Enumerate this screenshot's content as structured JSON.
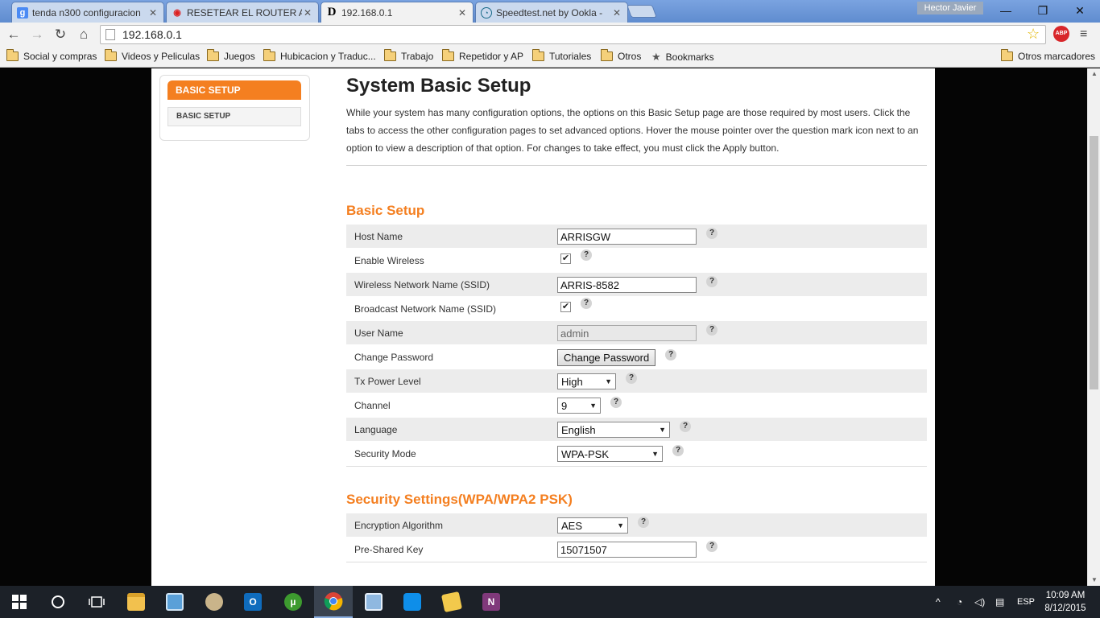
{
  "browser": {
    "tabs": [
      {
        "title": "tenda n300 configuracion",
        "favicon": "google-g-icon",
        "active": false
      },
      {
        "title": "RESETEAR EL ROUTER A L",
        "favicon": "youtube-play-icon",
        "active": false
      },
      {
        "title": "192.168.0.1",
        "favicon": "dlink-d-icon",
        "active": true
      },
      {
        "title": "Speedtest.net by Ookla - ",
        "favicon": "speedtest-gauge-icon",
        "active": false
      }
    ],
    "profile_name": "Hector Javier",
    "url": "192.168.0.1",
    "abp_label": "ABP",
    "bookmarks": [
      {
        "label": "Social y compras",
        "icon": "folder-icon"
      },
      {
        "label": "Videos y Peliculas",
        "icon": "folder-icon"
      },
      {
        "label": "Juegos",
        "icon": "folder-icon"
      },
      {
        "label": "Hubicacion y Traduc...",
        "icon": "folder-icon"
      },
      {
        "label": "Trabajo",
        "icon": "folder-icon"
      },
      {
        "label": "Repetidor y AP",
        "icon": "folder-icon"
      },
      {
        "label": "Tutoriales",
        "icon": "folder-icon"
      },
      {
        "label": "Otros",
        "icon": "folder-icon"
      },
      {
        "label": "Bookmarks",
        "icon": "star-icon"
      }
    ],
    "other_bookmarks": "Otros marcadores"
  },
  "sidebar": {
    "header": "BASIC SETUP",
    "items": [
      "BASIC SETUP"
    ]
  },
  "main": {
    "title": "System Basic Setup",
    "intro": "While your system has many configuration options, the options on this Basic Setup page are those required by most users. Click the tabs to access the other configuration pages to set advanced options. Hover the mouse pointer over the question mark icon next to an option to view a description of that option. For changes to take effect, you must click the Apply button.",
    "basic_setup": {
      "heading": "Basic Setup",
      "host_name_label": "Host Name",
      "host_name_value": "ARRISGW",
      "enable_wireless_label": "Enable Wireless",
      "enable_wireless_checked": true,
      "ssid_label": "Wireless Network Name (SSID)",
      "ssid_value": "ARRIS-8582",
      "broadcast_label": "Broadcast Network Name (SSID)",
      "broadcast_checked": true,
      "user_name_label": "User Name",
      "user_name_value": "admin",
      "change_password_label": "Change Password",
      "change_password_button": "Change Password",
      "tx_power_label": "Tx Power Level",
      "tx_power_value": "High",
      "channel_label": "Channel",
      "channel_value": "9",
      "language_label": "Language",
      "language_value": "English",
      "security_mode_label": "Security Mode",
      "security_mode_value": "WPA-PSK"
    },
    "security_settings": {
      "heading": "Security Settings(WPA/WPA2 PSK)",
      "encryption_label": "Encryption Algorithm",
      "encryption_value": "AES",
      "psk_label": "Pre-Shared Key",
      "psk_value": "15071507"
    },
    "help_glyph": "?",
    "check_glyph": "✔"
  },
  "taskbar": {
    "language": "ESP",
    "time": "10:09 AM",
    "date": "8/12/2015"
  },
  "colors": {
    "accent_orange": "#f47f20",
    "row_shade": "#ececec",
    "taskbar": "#1c2128"
  }
}
